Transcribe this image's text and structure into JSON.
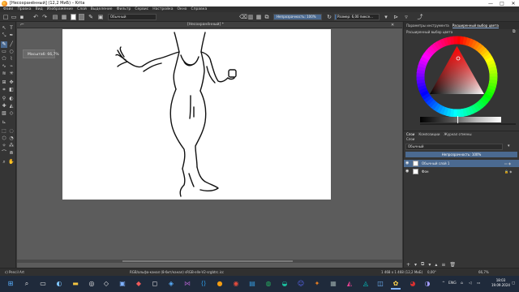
{
  "window": {
    "title": "[Несохранённый] (12,2 МиБ) – Krita",
    "min": "—",
    "max": "□",
    "close": "✕"
  },
  "menu": [
    "Файл",
    "Правка",
    "Вид",
    "Изображение",
    "Слой",
    "Выделение",
    "Фильтр",
    "Сервис",
    "Настройка",
    "Окно",
    "Справка"
  ],
  "toolbar": {
    "blend_mode": "Обычный",
    "opacity_label": "Непрозрачность: 100%",
    "opacity_value": 1.0,
    "size_label": "Размер: 6,00 пиксе..."
  },
  "document": {
    "tab_title": "[Несохранённый] *",
    "close": "✕"
  },
  "tooltip": "Масштаб: 66,7%",
  "docker": {
    "tabs": [
      "Параметры инструмента",
      "Расширенный выбор цвета"
    ],
    "active_tab": "Расширенный выбор цвета",
    "selector_title": "Расширенный выбор цвета",
    "colors": {
      "selected_hue": "#ff0000"
    }
  },
  "layers": {
    "tabs": [
      "Слои",
      "Композиции",
      "Журнал отмены"
    ],
    "active_tab": "Слои",
    "panel_title": "Слои",
    "blend_mode": "Обычный",
    "opacity_label": "Непрозрачность: 100%",
    "items": [
      {
        "name": "Обычный слой 1",
        "selected": true
      },
      {
        "name": "Фон",
        "selected": false
      }
    ]
  },
  "status": {
    "brush": "c) Pencil Art",
    "color_info": "RGB/альфа-канал (8-бит/канал) sRGB-elle-V2-srgbtrc.icc",
    "size_info": "1 468 x 1 468 (12,2 МиБ)",
    "rotation": "0,00°",
    "zoom": "66,7%"
  },
  "taskbar": {
    "lang": "ENG",
    "time": "18:03",
    "date": "19.09.2024"
  },
  "colors": {
    "accent": "#4b6a91",
    "window_bg": "#3a3a3a",
    "canvas_bg": "#5c5c5c",
    "taskbar_bg": "#1f2a3b"
  }
}
